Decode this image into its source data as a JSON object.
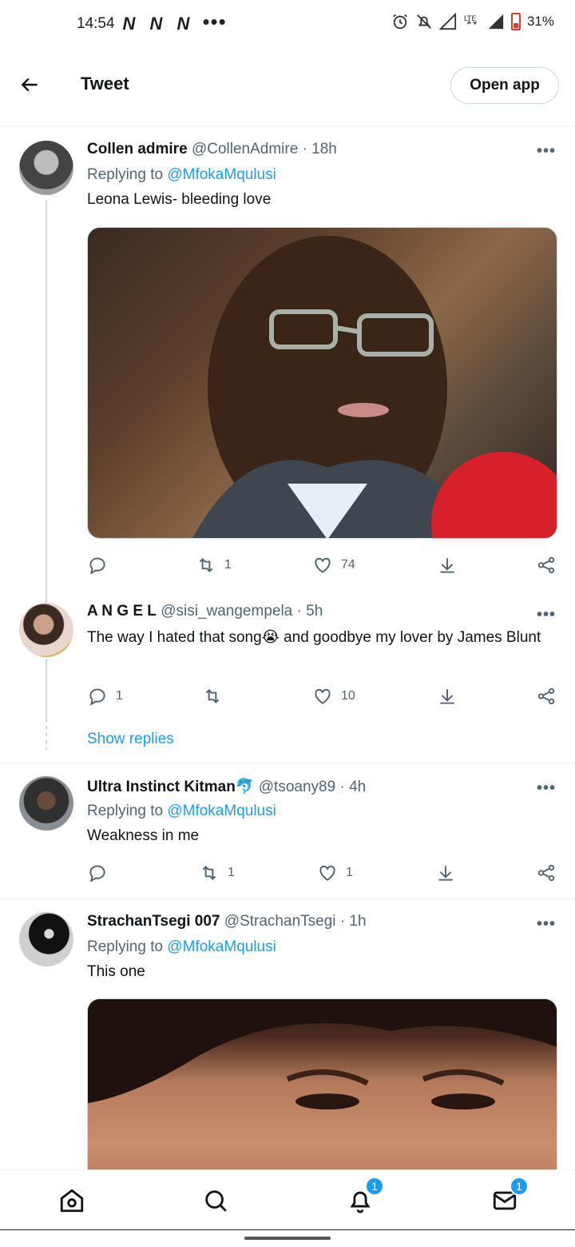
{
  "status_bar": {
    "time": "14:54",
    "notif_icons": "N N N",
    "more": "•••",
    "battery": "31%",
    "icons": [
      "alarm-icon",
      "mute-icon",
      "signal-icon",
      "lte-icon",
      "battery-icon"
    ]
  },
  "header": {
    "title": "Tweet",
    "open_app_label": "Open app"
  },
  "tweets": [
    {
      "name": "Collen admire",
      "handle": "@CollenAdmire",
      "time": "18h",
      "replying_label": "Replying to",
      "replying_to": "@MfokaMqulusi",
      "text": "Leona Lewis- bleeding  love",
      "retweets": "1",
      "likes": "74"
    },
    {
      "name": "A N G E L",
      "handle": "@sisi_wangempela",
      "time": "5h",
      "text": "The way I hated that song😭 and goodbye my lover by James Blunt",
      "replies": "1",
      "likes": "10",
      "show_replies": "Show replies"
    },
    {
      "name": "Ultra Instinct Kitman",
      "name_emoji": "🐬",
      "handle": "@tsoany89",
      "time": "4h",
      "replying_label": "Replying to",
      "replying_to": "@MfokaMqulusi",
      "text": "Weakness in me",
      "retweets": "1",
      "likes": "1"
    },
    {
      "name": "StrachanTsegi 007",
      "handle": "@StrachanTsegi",
      "time": "1h",
      "replying_label": "Replying to",
      "replying_to": "@MfokaMqulusi",
      "text": "This one"
    }
  ],
  "separator": "·",
  "bottom_nav": {
    "notifications_badge": "1",
    "messages_badge": "1",
    "icons": [
      "home-icon",
      "search-icon",
      "notifications-icon",
      "messages-icon"
    ]
  },
  "colors": {
    "accent": "#1d9bf0",
    "text": "#0f1419",
    "secondary": "#536471",
    "border": "#cfd9de"
  }
}
